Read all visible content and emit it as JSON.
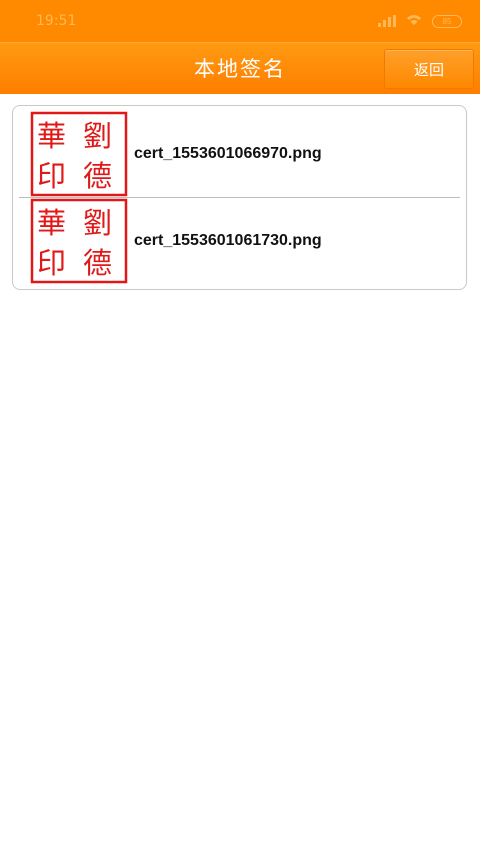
{
  "status_bar": {
    "time": "19:51",
    "icons": [
      "signal-icon",
      "wifi-icon",
      "battery-icon"
    ],
    "battery_level": "85"
  },
  "header": {
    "title": "本地签名",
    "back_label": "返回"
  },
  "colors": {
    "header_orange": "#ff8a00",
    "seal_red": "#e01818"
  },
  "files": [
    {
      "name": "cert_1553601066970.png",
      "seal": [
        "華",
        "劉",
        "印",
        "德"
      ]
    },
    {
      "name": "cert_1553601061730.png",
      "seal": [
        "華",
        "劉",
        "印",
        "德"
      ]
    }
  ]
}
